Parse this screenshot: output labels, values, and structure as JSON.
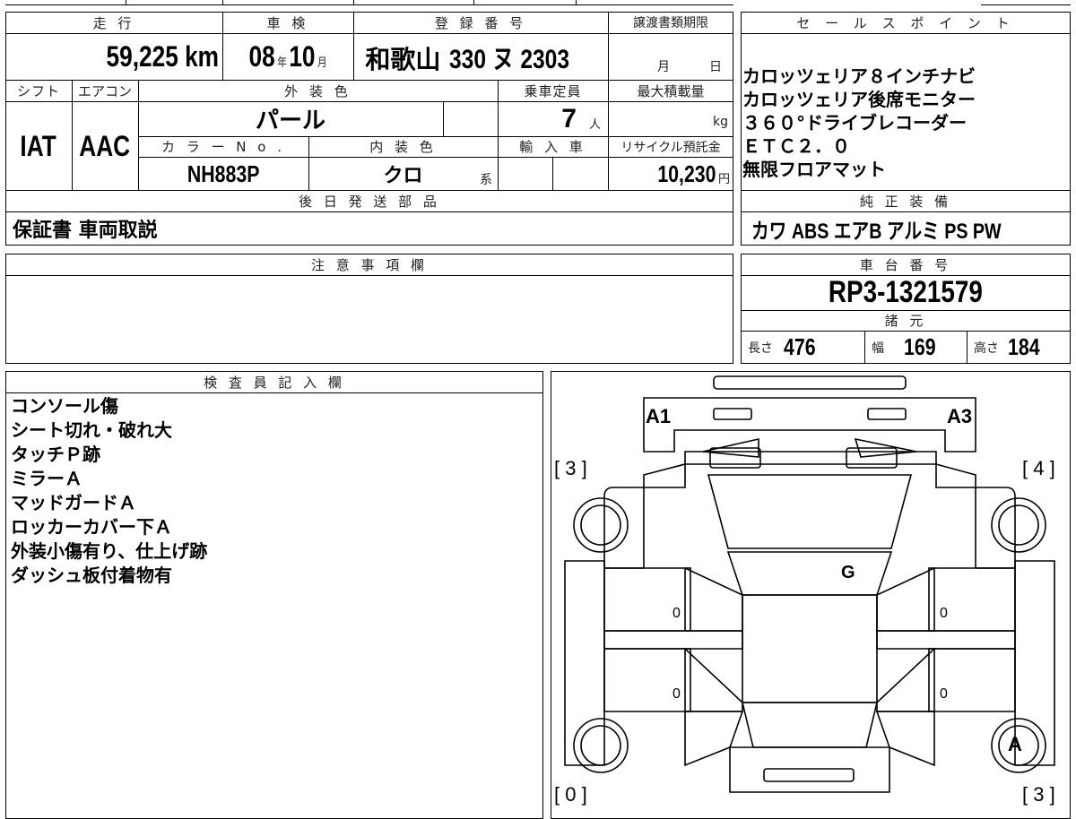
{
  "labels": {
    "mileage": "走 行",
    "inspection": "車 検",
    "registration": "登 録 番 号",
    "transfer_deadline": "譲渡書類期限",
    "sales_points": "セ ー ル ス ポ イ ン ト",
    "shift": "シフト",
    "aircon": "エアコン",
    "exterior_color": "外 装 色",
    "capacity": "乗車定員",
    "max_load": "最大積載量",
    "color_no": "カ ラ ー N o .",
    "interior_color": "内 装 色",
    "import": "輸 入 車",
    "recycle_fee": "リサイクル預託金",
    "later_parts": "後 日 発 送 部 品",
    "genuine_equipment": "純 正 装 備",
    "notes": "注 意 事 項 欄",
    "chassis_no": "車 台 番 号",
    "specs": "諸 元",
    "inspector_notes": "検 査 員 記 入 欄"
  },
  "vehicle": {
    "mileage": "59,225",
    "mileage_unit": "km",
    "inspection_year": "08",
    "year_unit": "年",
    "inspection_month": "10",
    "month_unit": "月",
    "registration_area": "和歌山",
    "registration_number": "330 ヌ 2303",
    "deadline_month_unit": "月",
    "deadline_day_unit": "日",
    "shift": "IAT",
    "aircon": "AAC",
    "exterior_color": "パール",
    "capacity": "7",
    "capacity_unit": "人",
    "max_load_unit": "kg",
    "color_no": "NH883P",
    "interior_color": "クロ",
    "interior_suffix": "系",
    "recycle_fee": "10,230",
    "recycle_unit": "円",
    "later_parts": "保証書 車両取説",
    "genuine_equipment": "カワ ABS エアB アルミ PS PW",
    "chassis_no": "RP3-1321579",
    "length_label": "長さ",
    "length": "476",
    "width_label": "幅",
    "width": "169",
    "height_label": "高さ",
    "height": "184"
  },
  "sales_points": [
    "カロッツェリア８インチナビ",
    "カロッツェリア後席モニター",
    "３６０°ドライブレコーダー",
    "ＥＴＣ２．０",
    "無限フロアマット"
  ],
  "inspector_notes": [
    "コンソール傷",
    "シート切れ・破れ大",
    "タッチＰ跡",
    "ミラーＡ",
    "マッドガードＡ",
    "ロッカーカバー下Ａ",
    "外装小傷有り、仕上げ跡",
    "ダッシュ板付着物有"
  ],
  "diagram": {
    "a1": "A1",
    "a3": "A3",
    "g": "G",
    "a_rear_wheel": "A",
    "tire_fl": "[ 3 ]",
    "tire_fr": "[ 4 ]",
    "tire_rl": "[ 0 ]",
    "tire_rr": "[ 3 ]",
    "door_fl": "0",
    "door_rl": "0",
    "door_fr": "0",
    "door_rr": "0"
  }
}
